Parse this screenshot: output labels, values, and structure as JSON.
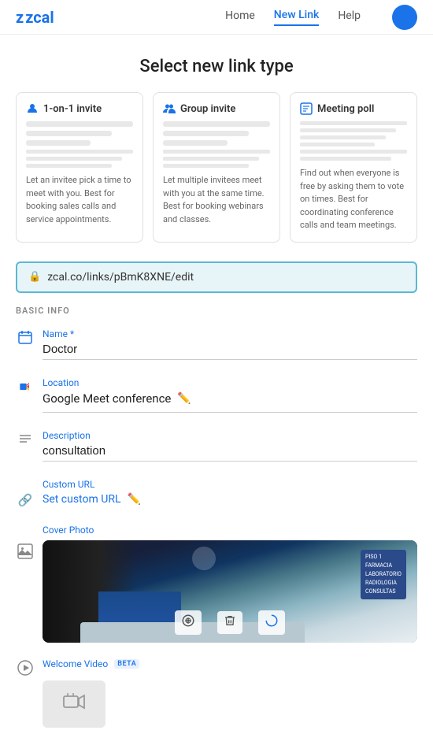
{
  "nav": {
    "logo": "zcal",
    "links": [
      {
        "label": "Home",
        "active": false
      },
      {
        "label": "New Link",
        "active": true
      },
      {
        "label": "Help",
        "active": false
      }
    ]
  },
  "page": {
    "title": "Select new link type"
  },
  "cards": [
    {
      "id": "one-on-one",
      "title": "1-on-1 invite",
      "icon": "person-icon",
      "icon_char": "👤",
      "desc": "Let an invitee pick a time to meet with you. Best for booking sales calls and service appointments."
    },
    {
      "id": "group",
      "title": "Group invite",
      "icon": "group-icon",
      "icon_char": "👥",
      "desc": "Let multiple invitees meet with you at the same time. Best for booking webinars and classes."
    },
    {
      "id": "poll",
      "title": "Meeting poll",
      "icon": "poll-icon",
      "icon_char": "📋",
      "desc": "Find out when everyone is free by asking them to vote on times. Best for coordinating conference calls and team meetings."
    }
  ],
  "url_bar": {
    "lock_icon": "🔒",
    "url": "zcal.co/links/pBmK8XNE/edit"
  },
  "form": {
    "section_label": "BASIC INFO",
    "name_label": "Name *",
    "name_value": "Doctor",
    "location_label": "Location",
    "location_value": "Google Meet conference",
    "description_label": "Description",
    "description_value": "consultation",
    "custom_url_label": "Custom URL",
    "custom_url_text": "Set custom URL",
    "cover_photo_label": "Cover Photo",
    "welcome_video_label": "Welcome Video",
    "beta_label": "BETA",
    "piso_lines": [
      "PISO 1",
      "FARMACIA",
      "LABORATORIO",
      "RADIOLOGIA",
      "CONSULTAS"
    ]
  }
}
